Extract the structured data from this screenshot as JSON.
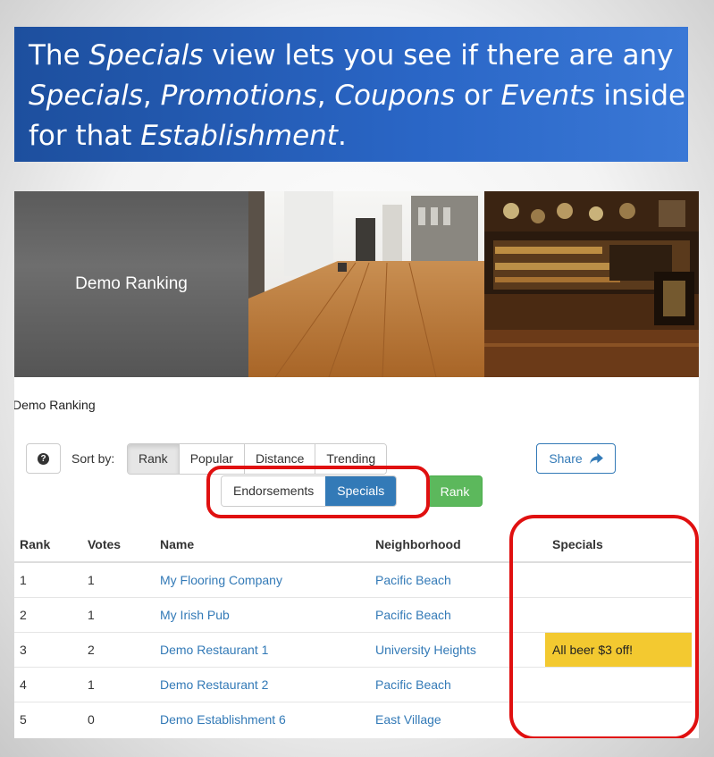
{
  "banner": {
    "parts": [
      {
        "text": "The ",
        "italic": false
      },
      {
        "text": "Specials",
        "italic": true
      },
      {
        "text": " view lets you see if there are any ",
        "italic": false
      },
      {
        "text": "Specials",
        "italic": true
      },
      {
        "text": ", ",
        "italic": false
      },
      {
        "text": "Promotions",
        "italic": true
      },
      {
        "text": ", ",
        "italic": false
      },
      {
        "text": "Coupons",
        "italic": true
      },
      {
        "text": " or ",
        "italic": false
      },
      {
        "text": "Events",
        "italic": true
      },
      {
        "text": " inside for that ",
        "italic": false
      },
      {
        "text": "Establishment",
        "italic": true
      },
      {
        "text": ".",
        "italic": false
      }
    ]
  },
  "hero": {
    "title": "Demo Ranking"
  },
  "caption": "Demo Ranking",
  "toolbar": {
    "help_glyph": "?",
    "sort_label": "Sort by:",
    "sort_options": [
      "Rank",
      "Popular",
      "Distance",
      "Trending"
    ],
    "sort_active": "Rank",
    "share_label": "Share",
    "views": [
      "Endorsements",
      "Specials"
    ],
    "view_active": "Specials",
    "rank_button": "Rank"
  },
  "table": {
    "headers": [
      "Rank",
      "Votes",
      "Name",
      "Neighborhood",
      "Specials"
    ],
    "rows": [
      {
        "rank": "1",
        "votes": "1",
        "name": "My Flooring Company",
        "neighborhood": "Pacific Beach",
        "special": ""
      },
      {
        "rank": "2",
        "votes": "1",
        "name": "My Irish Pub",
        "neighborhood": "Pacific Beach",
        "special": ""
      },
      {
        "rank": "3",
        "votes": "2",
        "name": "Demo Restaurant 1",
        "neighborhood": "University Heights",
        "special": "All beer $3 off!"
      },
      {
        "rank": "4",
        "votes": "1",
        "name": "Demo Restaurant 2",
        "neighborhood": "Pacific Beach",
        "special": ""
      },
      {
        "rank": "5",
        "votes": "0",
        "name": "Demo Establishment 6",
        "neighborhood": "East Village",
        "special": ""
      }
    ]
  },
  "colors": {
    "banner": "#2a66c6",
    "primary": "#337ab7",
    "success": "#5cb85c",
    "special_highlight": "#f3c930",
    "annotation_red": "#e01010"
  },
  "icons": {
    "help": "question-circle-icon",
    "share": "share-arrow-icon"
  }
}
